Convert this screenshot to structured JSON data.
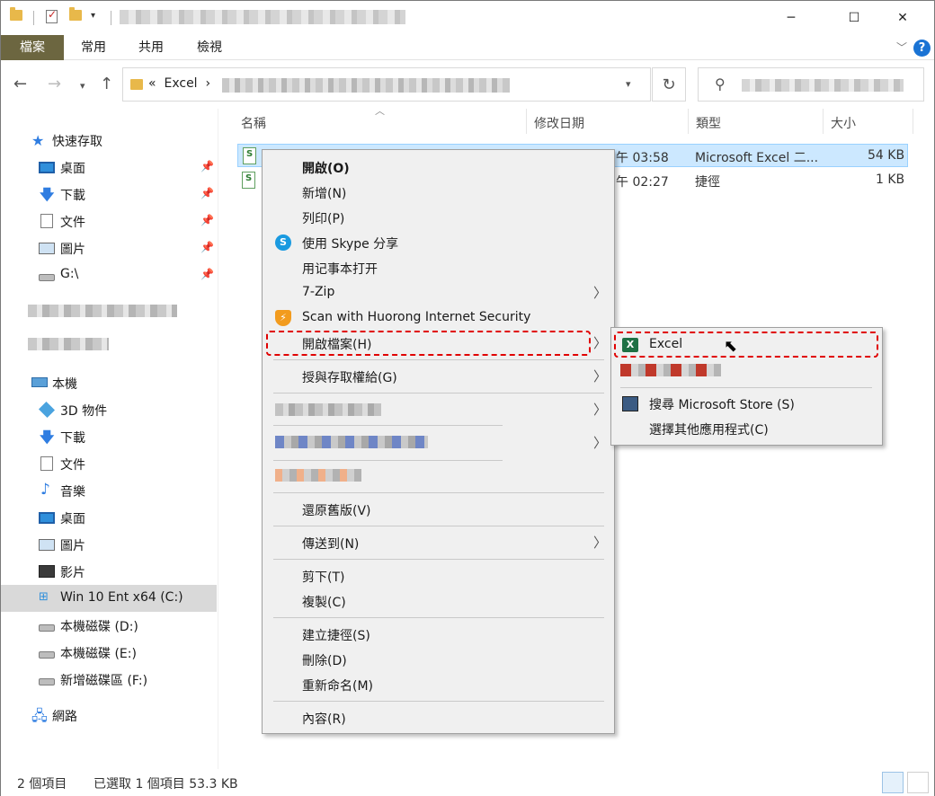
{
  "ribbon": {
    "tabs": [
      "檔案",
      "常用",
      "共用",
      "檢視"
    ]
  },
  "address": {
    "segment": "Excel",
    "prefix": "«"
  },
  "nav": {
    "quick_access": "快速存取",
    "qa_items": [
      "桌面",
      "下載",
      "文件",
      "圖片",
      "G:\\"
    ],
    "this_pc": "本機",
    "pc_items": [
      "3D 物件",
      "下載",
      "文件",
      "音樂",
      "桌面",
      "圖片",
      "影片"
    ],
    "drives": [
      "Win 10 Ent x64 (C:)",
      "本機磁碟 (D:)",
      "本機磁碟 (E:)",
      "新增磁碟區 (F:)"
    ],
    "network": "網路"
  },
  "columns": {
    "name": "名稱",
    "modified": "修改日期",
    "type": "類型",
    "size": "大小"
  },
  "files": [
    {
      "time": "午 03:58",
      "type": "Microsoft Excel 二...",
      "size": "54 KB"
    },
    {
      "time": "午 02:27",
      "type": "捷徑",
      "size": "1 KB"
    }
  ],
  "context_menu": {
    "open": "開啟(O)",
    "new": "新增(N)",
    "print": "列印(P)",
    "skype": "使用 Skype 分享",
    "notepad": "用记事本打开",
    "zip": "7-Zip",
    "huorong": "Scan with Huorong Internet Security",
    "open_with": "開啟檔案(H)",
    "grant_access": "授與存取權給(G)",
    "restore": "還原舊版(V)",
    "send_to": "傳送到(N)",
    "cut": "剪下(T)",
    "copy": "複製(C)",
    "shortcut": "建立捷徑(S)",
    "delete": "刪除(D)",
    "rename": "重新命名(M)",
    "properties": "內容(R)"
  },
  "submenu": {
    "excel": "Excel",
    "store": "搜尋 Microsoft Store (S)",
    "choose": "選擇其他應用程式(C)"
  },
  "status": {
    "count": "2 個項目",
    "selected": "已選取 1 個項目  53.3 KB"
  },
  "colors": {
    "ribbon_active": "#6c6640",
    "highlight": "#e00000",
    "selection": "#cce8ff"
  }
}
